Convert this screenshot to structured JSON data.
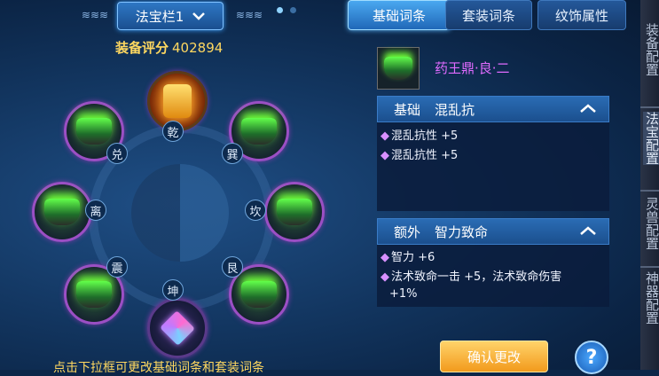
{
  "slot_selector": {
    "label": "法宝栏1",
    "page_dots": 2,
    "active_dot": 0
  },
  "score": {
    "label": "装备评分",
    "value": "402894"
  },
  "trigrams": [
    "乾",
    "巽",
    "坎",
    "艮",
    "坤",
    "震",
    "离",
    "兑"
  ],
  "hint": "点击下拉框可更改基础词条和套装词条",
  "tabs": [
    "基础词条",
    "套装词条",
    "纹饰属性"
  ],
  "active_tab": 0,
  "item": {
    "name": "药王鼎·良·二"
  },
  "basic_panel": {
    "title": "基础",
    "affix": "混乱抗",
    "lines": [
      "混乱抗性 +5",
      "混乱抗性 +5"
    ]
  },
  "extra_panel": {
    "title": "额外",
    "affix": "智力致命",
    "lines": [
      "智力 +6",
      "法术致命一击 +5，法术致命伤害",
      "+1%"
    ]
  },
  "buttons": {
    "confirm": "确认更改",
    "help": "?"
  },
  "side_tabs": [
    "装备配置",
    "法宝配置",
    "灵兽配置",
    "神器配置"
  ],
  "colors": {
    "score": "#ffd860",
    "item_name": "#e06bff",
    "slot_border": "#9b4fc4",
    "accent": "#4aa8f0"
  }
}
